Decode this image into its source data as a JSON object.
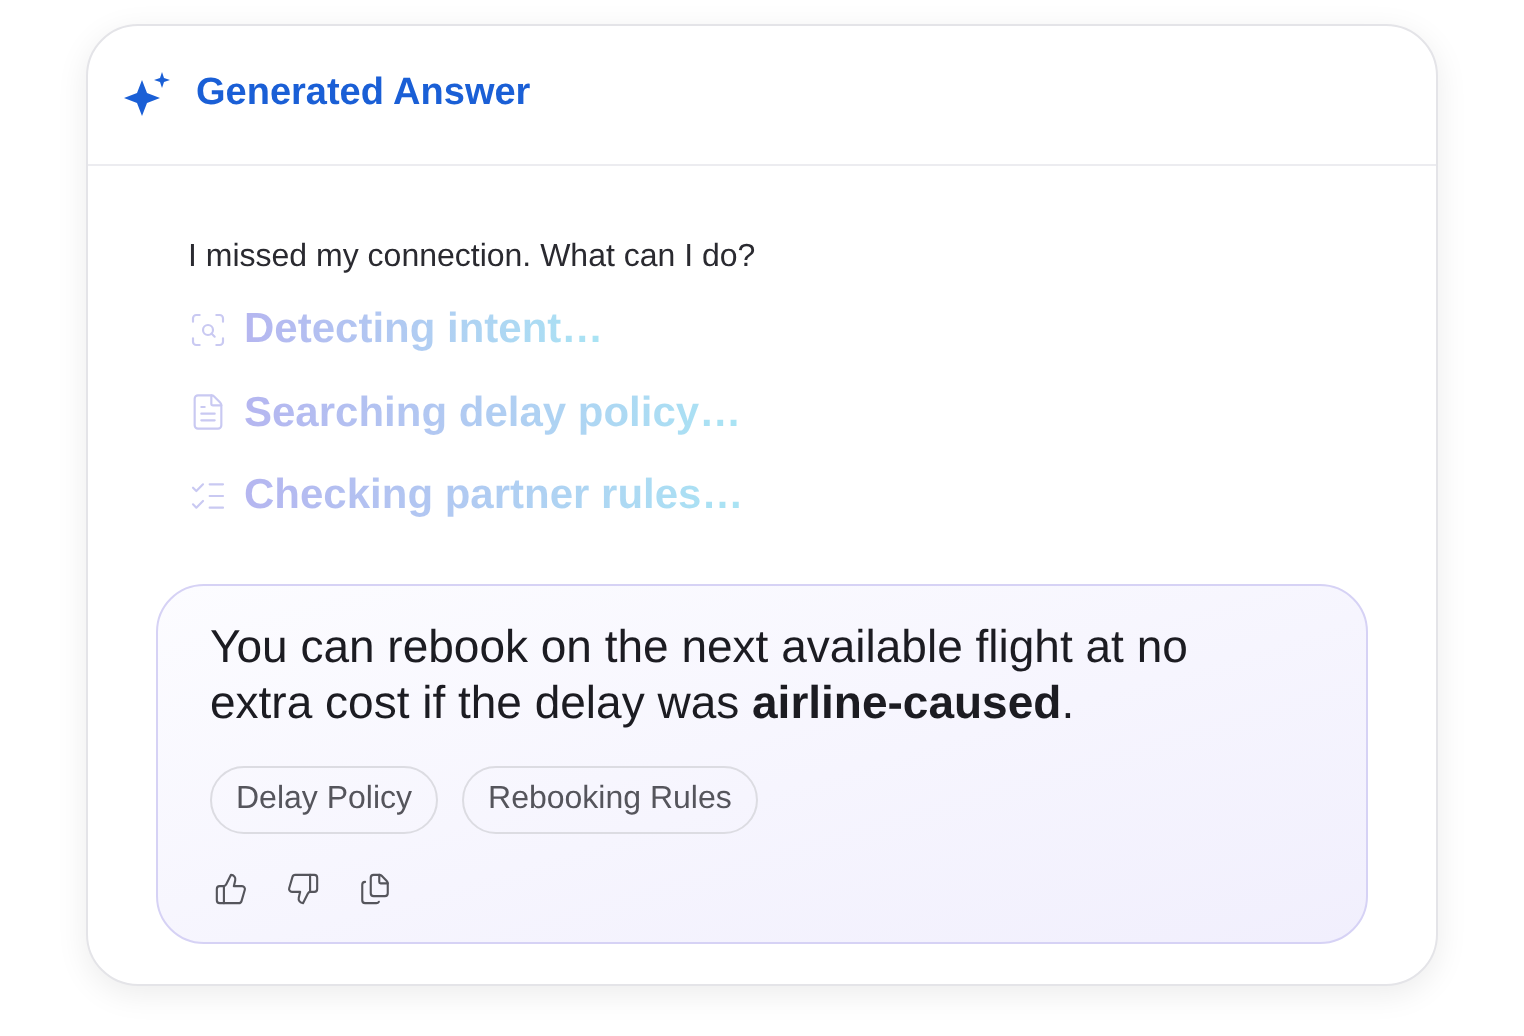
{
  "header": {
    "title": "Generated Answer"
  },
  "question": "I missed my connection. What can I do?",
  "steps": [
    {
      "kind": "intent",
      "label": "Detecting intent…"
    },
    {
      "kind": "document",
      "label": "Searching delay policy…"
    },
    {
      "kind": "checklist",
      "label": "Checking partner rules…"
    }
  ],
  "answer": {
    "text": "You can rebook on the next available flight at no extra cost if the delay was **airline-caused**.",
    "sources": [
      "Delay Policy",
      "Rebooking Rules"
    ],
    "actions": [
      {
        "kind": "like"
      },
      {
        "kind": "dislike"
      },
      {
        "kind": "copy"
      }
    ]
  }
}
